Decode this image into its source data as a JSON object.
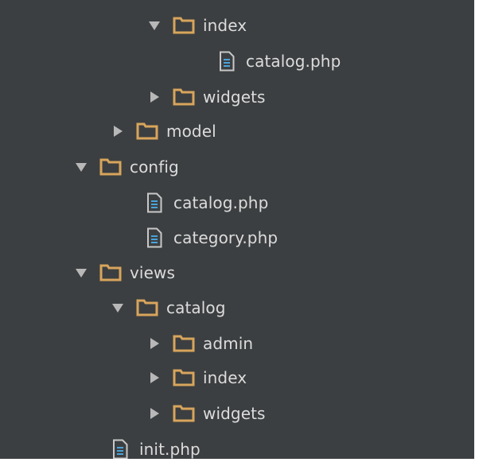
{
  "colors": {
    "background": "#3c3f41",
    "text": "#dcdcdc",
    "folder": "#d8a55c",
    "file_accent": "#4aa3d9",
    "arrow": "#b8b8b8"
  },
  "tree": {
    "items": [
      {
        "label": "index",
        "type": "folder",
        "state": "expanded"
      },
      {
        "label": "catalog.php",
        "type": "file"
      },
      {
        "label": "widgets",
        "type": "folder",
        "state": "collapsed"
      },
      {
        "label": "model",
        "type": "folder",
        "state": "collapsed"
      },
      {
        "label": "config",
        "type": "folder",
        "state": "expanded"
      },
      {
        "label": "catalog.php",
        "type": "file"
      },
      {
        "label": "category.php",
        "type": "file"
      },
      {
        "label": "views",
        "type": "folder",
        "state": "expanded"
      },
      {
        "label": "catalog",
        "type": "folder",
        "state": "expanded"
      },
      {
        "label": "admin",
        "type": "folder",
        "state": "collapsed"
      },
      {
        "label": "index",
        "type": "folder",
        "state": "collapsed"
      },
      {
        "label": "widgets",
        "type": "folder",
        "state": "collapsed"
      },
      {
        "label": "init.php",
        "type": "file"
      }
    ]
  }
}
